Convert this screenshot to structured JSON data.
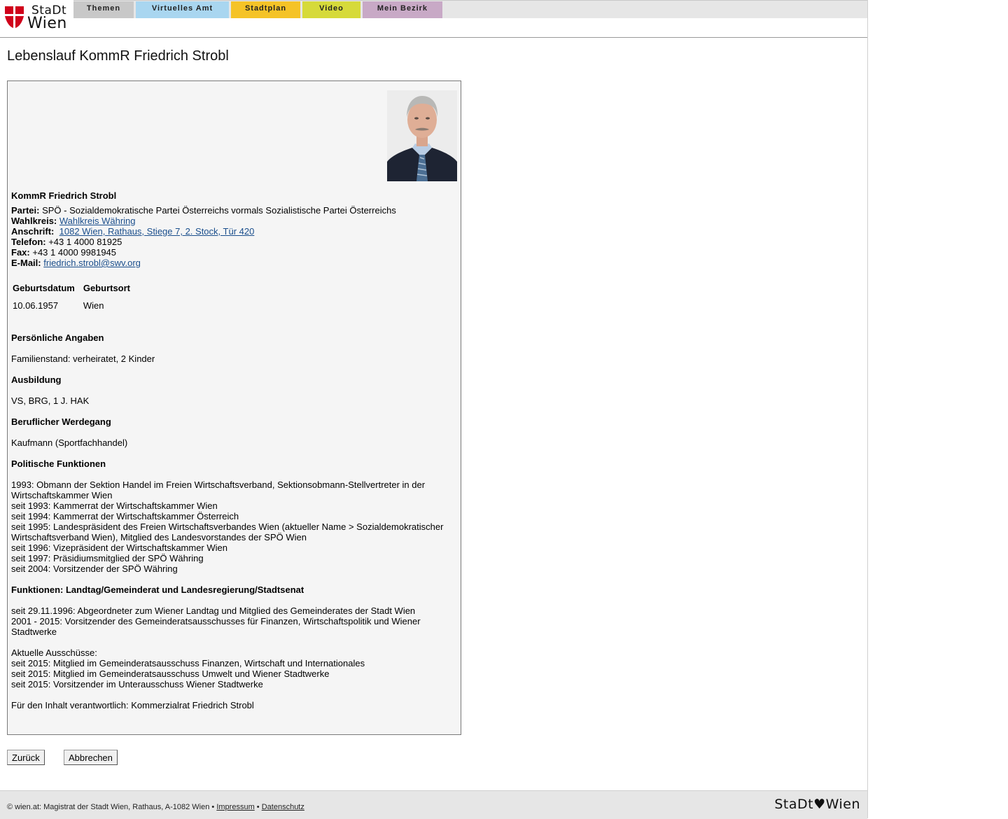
{
  "header": {
    "logo": {
      "line1": "StaDt",
      "line2": "Wien"
    },
    "nav": [
      {
        "label": "Themen",
        "color": "#c8c8c8"
      },
      {
        "label": "Virtuelles Amt",
        "color": "#a9d6f0"
      },
      {
        "label": "Stadtplan",
        "color": "#f5c327"
      },
      {
        "label": "Video",
        "color": "#d6da3a"
      },
      {
        "label": "Mein Bezirk",
        "color": "#c8a9c6"
      }
    ]
  },
  "page_title": "Lebenslauf KommR Friedrich Strobl",
  "profile": {
    "name": "KommR Friedrich Strobl",
    "partei_label": "Partei:",
    "partei": "SPÖ - Sozialdemokratische Partei Österreichs vormals Sozialistische Partei Österreichs",
    "wahlkreis_label": "Wahlkreis:",
    "wahlkreis": "Wahlkreis Währing",
    "anschrift_label": "Anschrift:",
    "anschrift": "1082 Wien, Rathaus, Stiege 7, 2. Stock, Tür 420",
    "telefon_label": "Telefon:",
    "telefon": "+43 1 4000 81925",
    "fax_label": "Fax:",
    "fax": "+43 1 4000 9981945",
    "email_label": "E-Mail:",
    "email": "friedrich.strobl@swv.org",
    "table": {
      "headers": [
        "Geburtsdatum",
        "Geburtsort"
      ],
      "row": [
        "10.06.1957",
        "Wien"
      ]
    },
    "sections": [
      {
        "heading": "Persönliche Angaben",
        "lines": [
          "Familienstand: verheiratet, 2 Kinder"
        ]
      },
      {
        "heading": "Ausbildung",
        "lines": [
          "VS, BRG, 1 J. HAK"
        ]
      },
      {
        "heading": "Beruflicher Werdegang",
        "lines": [
          "Kaufmann (Sportfachhandel)"
        ]
      },
      {
        "heading": "Politische Funktionen",
        "lines": [
          "1993: Obmann der Sektion Handel im Freien Wirtschaftsverband, Sektionsobmann-Stellvertreter in der Wirtschaftskammer Wien",
          "seit 1993: Kammerrat der Wirtschaftskammer Wien",
          "seit 1994: Kammerrat der Wirtschaftskammer Österreich",
          "seit 1995: Landespräsident des Freien Wirtschaftsverbandes Wien (aktueller Name > Sozialdemokratischer Wirtschaftsverband Wien), Mitglied des Landesvorstandes der SPÖ Wien",
          "seit 1996: Vizepräsident der Wirtschaftskammer Wien",
          "seit 1997: Präsidiumsmitglied der SPÖ Währing",
          "seit 2004: Vorsitzender der SPÖ Währing"
        ]
      },
      {
        "heading": "Funktionen: Landtag/Gemeinderat und Landesregierung/Stadtsenat",
        "lines": [
          "seit 29.11.1996: Abgeordneter zum Wiener Landtag und Mitglied des Gemeinderates der Stadt Wien",
          "2001 - 2015: Vorsitzender des Gemeinderatsausschusses für Finanzen, Wirtschaftspolitik und Wiener Stadtwerke"
        ]
      }
    ],
    "ausschuesse_title": "Aktuelle Ausschüsse:",
    "ausschuesse": [
      "seit 2015: Mitglied im Gemeinderatsausschuss Finanzen, Wirtschaft und Internationales",
      "seit 2015: Mitglied im Gemeinderatsausschuss Umwelt und Wiener Stadtwerke",
      "seit 2015: Vorsitzender im Unterausschuss Wiener Stadtwerke"
    ],
    "responsible": "Für den Inhalt verantwortlich: Kommerzialrat Friedrich Strobl"
  },
  "buttons": {
    "back": "Zurück",
    "cancel": "Abbrechen"
  },
  "footer": {
    "text": "© wien.at: Magistrat der Stadt Wien, Rathaus, A-1082 Wien •",
    "impressum": "Impressum",
    "separator": "•",
    "datenschutz": "Datenschutz",
    "logo": "StaDt♥Wien"
  }
}
